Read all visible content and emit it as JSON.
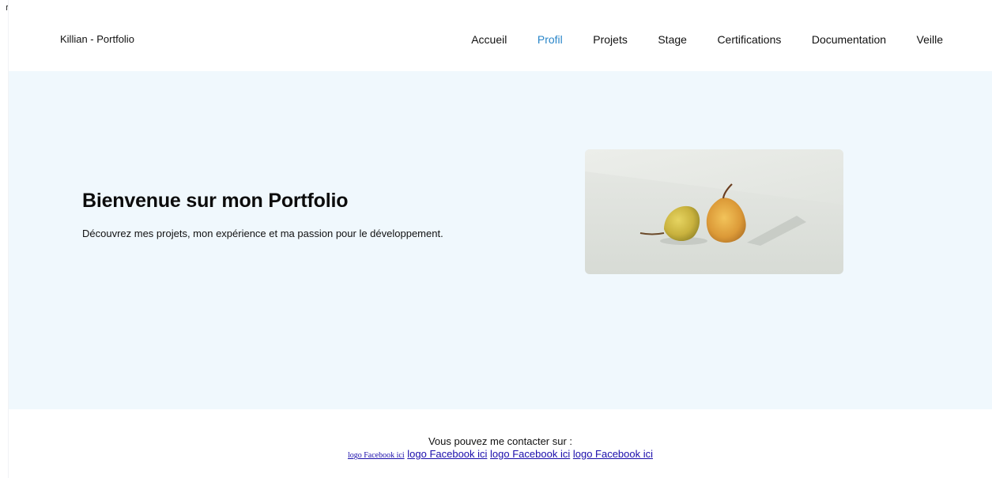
{
  "header": {
    "brand": "Killian - Portfolio",
    "nav": [
      {
        "label": "Accueil",
        "active": false
      },
      {
        "label": "Profil",
        "active": true
      },
      {
        "label": "Projets",
        "active": false
      },
      {
        "label": "Stage",
        "active": false
      },
      {
        "label": "Certifications",
        "active": false
      },
      {
        "label": "Documentation",
        "active": false
      },
      {
        "label": "Veille",
        "active": false
      }
    ]
  },
  "hero": {
    "title": "Bienvenue sur mon Portfolio",
    "subtitle": "Découvrez mes projets, mon expérience et ma passion pour le développement.",
    "image_subject": "two-pears"
  },
  "footer": {
    "contact_text": "Vous pouvez me contacter sur :",
    "links": [
      "logo Facebook ici",
      "logo Facebook ici",
      "logo Facebook ici",
      "logo Facebook ici"
    ]
  },
  "colors": {
    "hero_background": "#f0f8fd",
    "active_nav": "#2a86c9",
    "link": "#1a0dab"
  }
}
